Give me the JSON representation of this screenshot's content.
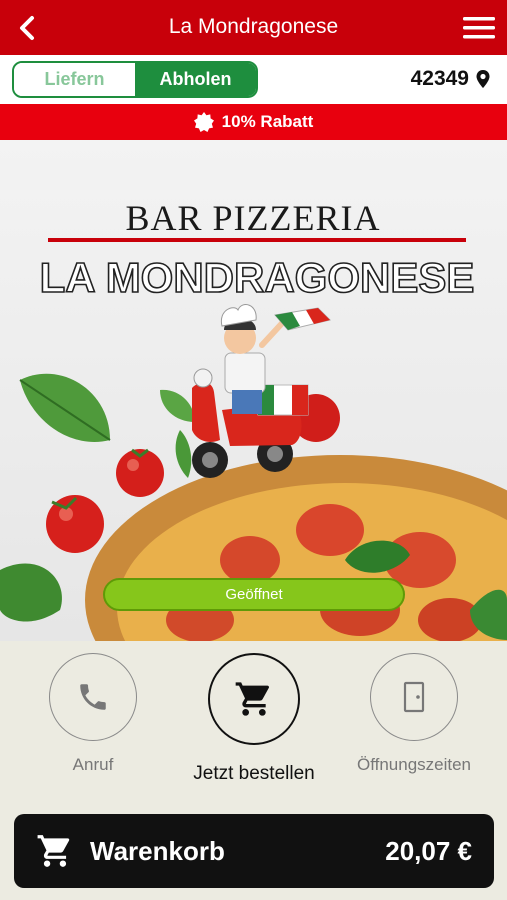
{
  "header": {
    "title": "La Mondragonese"
  },
  "mode": {
    "liefern_label": "Liefern",
    "abholen_label": "Abholen",
    "selected": "Abholen"
  },
  "location": {
    "zip": "42349"
  },
  "promo": {
    "text": "10% Rabatt"
  },
  "hero": {
    "line1": "BAR PIZZERIA",
    "line2": "LA MONDRAGONESE",
    "status": "Geöffnet"
  },
  "actions": {
    "call_label": "Anruf",
    "order_label": "Jetzt bestellen",
    "hours_label": "Öffnungszeiten"
  },
  "cart": {
    "label": "Warenkorb",
    "total": "20,07 €"
  },
  "colors": {
    "brand_red": "#c8000a",
    "promo_red": "#e8000e",
    "toggle_green": "#1e8e3e",
    "open_green": "#86c61b"
  }
}
